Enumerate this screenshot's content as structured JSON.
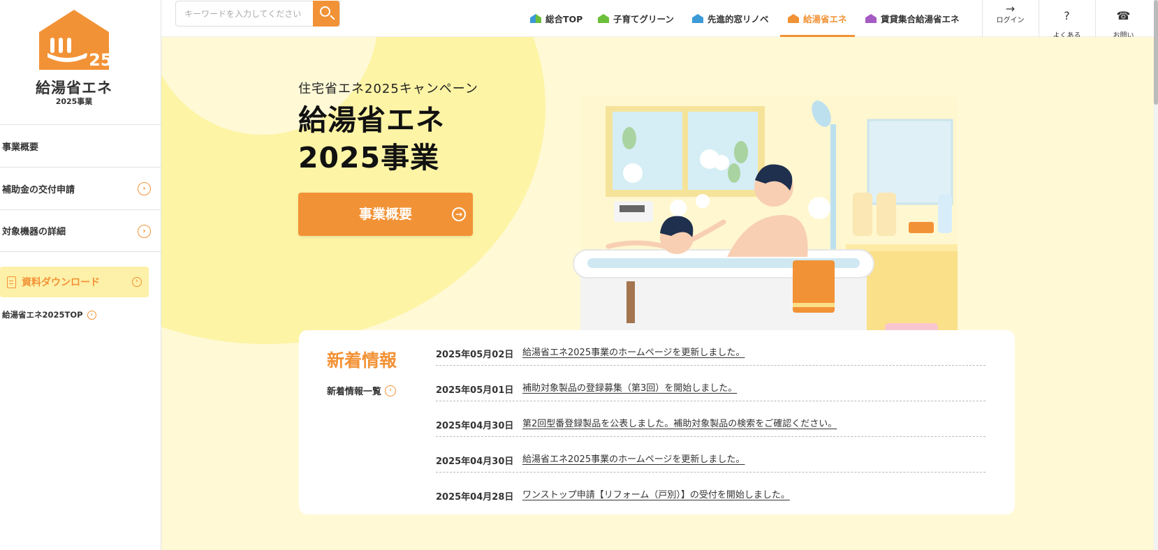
{
  "sidebar": {
    "logo_name": "給湯省エネ",
    "logo_sub": "2025事業",
    "logo_year": "’25",
    "items": [
      {
        "label": "事業概要"
      },
      {
        "label": "補助金の交付申請",
        "arrow": "›"
      },
      {
        "label": "対象機器の詳細",
        "arrow": "›"
      }
    ],
    "download_label": "資料ダウンロード",
    "top_link": "給湯省エネ2025TOP"
  },
  "header": {
    "search_placeholder": "キーワードを入力してください",
    "tabs": [
      {
        "label": "総合TOP",
        "icon": "house-icon"
      },
      {
        "label": "子育てグリーン",
        "icon": "house-icon"
      },
      {
        "label": "先進的窓リノベ",
        "icon": "house-icon"
      },
      {
        "label": "給湯省エネ",
        "icon": "house-icon"
      },
      {
        "label": "賃貸集合給湯省エネ",
        "icon": "house-icon"
      }
    ],
    "util": [
      {
        "label": "ログイン",
        "icon": "→"
      },
      {
        "label": "よくある\nご質問",
        "icon": "?"
      },
      {
        "label": "お問い\n合わせ",
        "icon": "☎"
      }
    ]
  },
  "hero": {
    "eyebrow": "住宅省エネ2025キャンペーン",
    "title_line1": "給湯省エネ",
    "title_line2": "2025事業",
    "button": "事業概要"
  },
  "news": {
    "title": "新着情報",
    "more": "新着情報一覧",
    "items": [
      {
        "date": "2025年05月02日",
        "text": "給湯省エネ2025事業のホームページを更新しました。"
      },
      {
        "date": "2025年05月01日",
        "text": "補助対象製品の登録募集（第3回）を開始しました。"
      },
      {
        "date": "2025年04月30日",
        "text": "第2回型番登録製品を公表しました。補助対象製品の検索をご確認ください。"
      },
      {
        "date": "2025年04月30日",
        "text": "給湯省エネ2025事業のホームページを更新しました。"
      },
      {
        "date": "2025年04月28日",
        "text": "ワンストップ申請【リフォーム（戸別）】の受付を開始しました。"
      }
    ]
  },
  "colors": {
    "accent": "#f29236",
    "hero_bg": "#fff9d6",
    "circle": "#fdf4a5",
    "tab_icons": [
      "#3c9ad6",
      "#6cbf3b",
      "#3c9ad6",
      "#f29236",
      "#a45bc2"
    ]
  }
}
